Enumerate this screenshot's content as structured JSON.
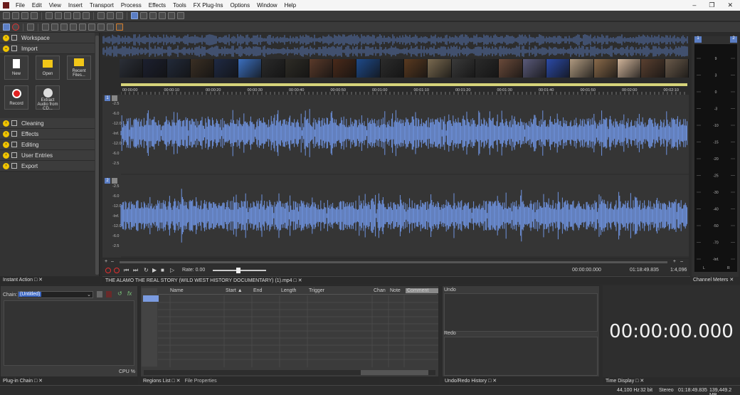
{
  "menu": [
    "File",
    "Edit",
    "View",
    "Insert",
    "Transport",
    "Process",
    "Effects",
    "Tools",
    "FX Plug-Ins",
    "Options",
    "Window",
    "Help"
  ],
  "left_panel": {
    "sections": [
      "Workspace",
      "Import",
      "Cleaning",
      "Effects",
      "Editing",
      "User Entries",
      "Export"
    ],
    "tiles": {
      "new": "New",
      "open": "Open",
      "recent": "Recent Files...",
      "record": "Record",
      "extract": "Extract Audio from CD..."
    },
    "title": "Instant Action"
  },
  "ruler_ticks": [
    "00:00:00",
    "00:00:10",
    "00:00:20",
    "00:00:30",
    "00:00:40",
    "00:00:50",
    "00:01:00",
    "00:01:10",
    "00:01:20",
    "00:01:30",
    "00:01:40",
    "00:01:50",
    "00:02:00",
    "00:02:10"
  ],
  "db_scale": [
    "-2.5",
    "-6.0",
    "-12.0",
    "-Inf.",
    "-12.0",
    "-6.0",
    "-2.5"
  ],
  "channel_numbers": [
    "1",
    "2"
  ],
  "transport": {
    "rate": "Rate: 0.00",
    "time_start": "00:00:00.000",
    "time_end": "01:18:49.835",
    "zoom": "1:4,096"
  },
  "file_tab": "THE ALAMO THE REAL STORY (WILD WEST HISTORY DOCUMENTARY) (1).mp4",
  "meters": {
    "title": "Channel Meters",
    "ticks": [
      "9",
      "3",
      "0",
      "-3",
      "-10",
      "-15",
      "-20",
      "-25",
      "-30",
      "-40",
      "-50",
      "-70",
      "-Inf."
    ],
    "channels_top": [
      "1",
      "2"
    ],
    "channels_bottom": [
      "L",
      "R"
    ]
  },
  "plugin_chain": {
    "chain_label": "Chain:",
    "chain_value": "(Untitled)",
    "cpu": "CPU %",
    "title": "Plug-in Chain"
  },
  "regions": {
    "columns": [
      "Name",
      "Start ▲",
      "End",
      "Length",
      "Trigger",
      "Chan",
      "Note",
      "Comment"
    ],
    "tabs": [
      "Regions List",
      "File Properties"
    ]
  },
  "undo": {
    "undo_label": "Undo",
    "redo_label": "Redo",
    "title": "Undo/Redo History"
  },
  "time_display": {
    "value": "00:00:00.000",
    "title": "Time Display"
  },
  "status": {
    "sample_rate": "44,100 Hz",
    "bit_depth": "32 bit",
    "channels": "Stereo",
    "duration": "01:18:49.835",
    "size": "139,449.2 MB"
  },
  "colors": {
    "waveform": "#6f93e0",
    "accent": "#5b7ec4",
    "section_chevron": "#f0c400"
  }
}
